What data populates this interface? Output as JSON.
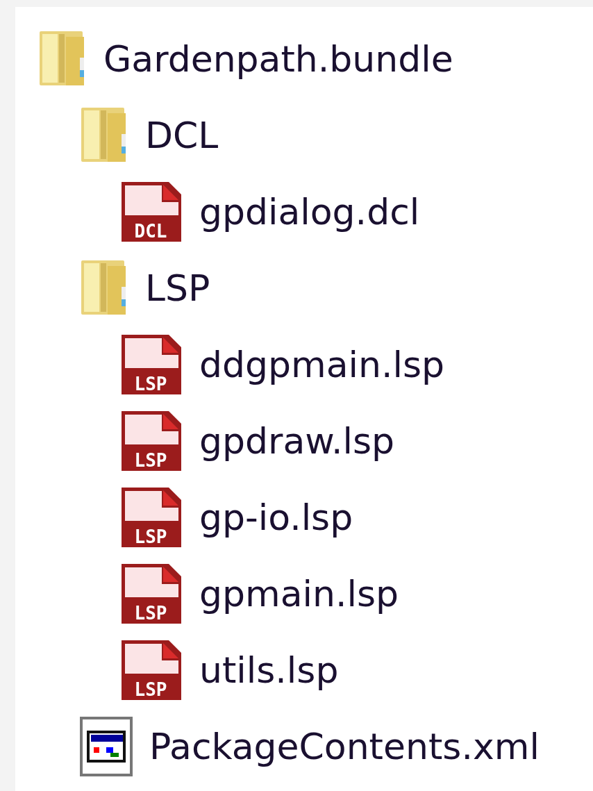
{
  "tree": [
    {
      "kind": "folder",
      "label": "Gardenpath.bundle",
      "children": [
        {
          "kind": "folder",
          "label": "DCL",
          "children": [
            {
              "kind": "file",
              "label": "gpdialog.dcl",
              "badge": "DCL"
            }
          ]
        },
        {
          "kind": "folder",
          "label": "LSP",
          "children": [
            {
              "kind": "file",
              "label": "ddgpmain.lsp",
              "badge": "LSP"
            },
            {
              "kind": "file",
              "label": "gpdraw.lsp",
              "badge": "LSP"
            },
            {
              "kind": "file",
              "label": "gp-io.lsp",
              "badge": "LSP"
            },
            {
              "kind": "file",
              "label": "gpmain.lsp",
              "badge": "LSP"
            },
            {
              "kind": "file",
              "label": "utils.lsp",
              "badge": "LSP"
            }
          ]
        },
        {
          "kind": "xml",
          "label": "PackageContents.xml"
        }
      ]
    }
  ]
}
